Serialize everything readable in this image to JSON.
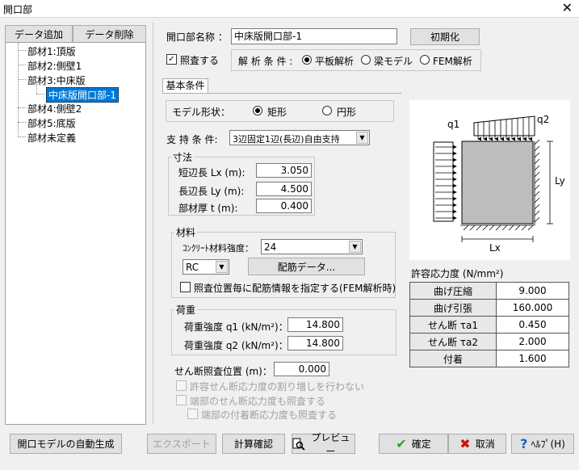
{
  "window": {
    "title": "開口部",
    "close_glyph": "✕"
  },
  "sidebar": {
    "add_button": "データ追加",
    "delete_button": "データ削除",
    "tree": [
      "部材1:頂版",
      "部材2:側壁1",
      "部材3:中床版",
      "中床版開口部-1",
      "部材4:側壁2",
      "部材5:底版",
      "部材未定義"
    ]
  },
  "header": {
    "name_label": "開口部名称 ：",
    "name_value": "中床版開口部-1",
    "init_button": "初期化",
    "check_label": "照査する",
    "check_mark": "✓",
    "analysis_label": "解 析 条 件 :",
    "analysis_options": [
      "平板解析",
      "梁モデル",
      "FEM解析"
    ],
    "analysis_selected": 0
  },
  "tabs": {
    "basic": "基本条件"
  },
  "model": {
    "label": "モデル形状：",
    "options": [
      "矩形",
      "円形"
    ],
    "selected": 0
  },
  "support": {
    "label": "支 持 条 件:",
    "value": "3辺固定1辺(長辺)自由支持"
  },
  "dimensions": {
    "group_label": "寸法",
    "short_label": "短辺長 Lx (m):",
    "short_value": "3.050",
    "long_label": "長辺長 Ly (m):",
    "long_value": "4.500",
    "thick_label": "部材厚 t (m):",
    "thick_value": "0.400"
  },
  "material": {
    "group_label": "材料",
    "concrete_label": "ｺﾝｸﾘｰﾄ材料強度：",
    "concrete_value": "24",
    "type_value": "RC",
    "rebar_button": "配筋データ...",
    "specify_label": "照査位置毎に配筋情報を指定する(FEM解析時)"
  },
  "load": {
    "group_label": "荷重",
    "q1_label": "荷重強度 q1 (kN/m²)：",
    "q1_value": "14.800",
    "q2_label": "荷重強度 q2 (kN/m²)：",
    "q2_value": "14.800"
  },
  "shear": {
    "position_label": "せん断照査位置 (m)：",
    "position_value": "0.000",
    "no_increase_label": "許容せん断応力度の割り増しを行わない",
    "edge_shear_label": "端部のせん断応力度も照査する",
    "edge_bond_label": "端部の付着断応力度も照査する"
  },
  "diagram": {
    "q1": "q1",
    "q2": "q2",
    "lx": "Lx",
    "ly": "Ly"
  },
  "stress_table": {
    "title": "許容応力度 (N/mm²)",
    "rows": [
      {
        "name": "曲げ圧縮",
        "value": "9.000"
      },
      {
        "name": "曲げ引張",
        "value": "160.000"
      },
      {
        "name": "せん断 τa1",
        "value": "0.450"
      },
      {
        "name": "せん断 τa2",
        "value": "2.000"
      },
      {
        "name": "付着",
        "value": "1.600"
      }
    ]
  },
  "footer": {
    "auto_button": "開口モデルの自動生成",
    "export_button": "エクスポート",
    "calc_button": "計算確認",
    "preview_button": "プレビュー",
    "ok_button": "確定",
    "cancel_button": "取消",
    "help_button": "ﾍﾙﾌﾟ(H)"
  },
  "colors": {
    "selection": "#0078d7",
    "ok_check": "#2e9e2e",
    "cancel_x": "#d01010",
    "help_blue": "#1060c8"
  }
}
